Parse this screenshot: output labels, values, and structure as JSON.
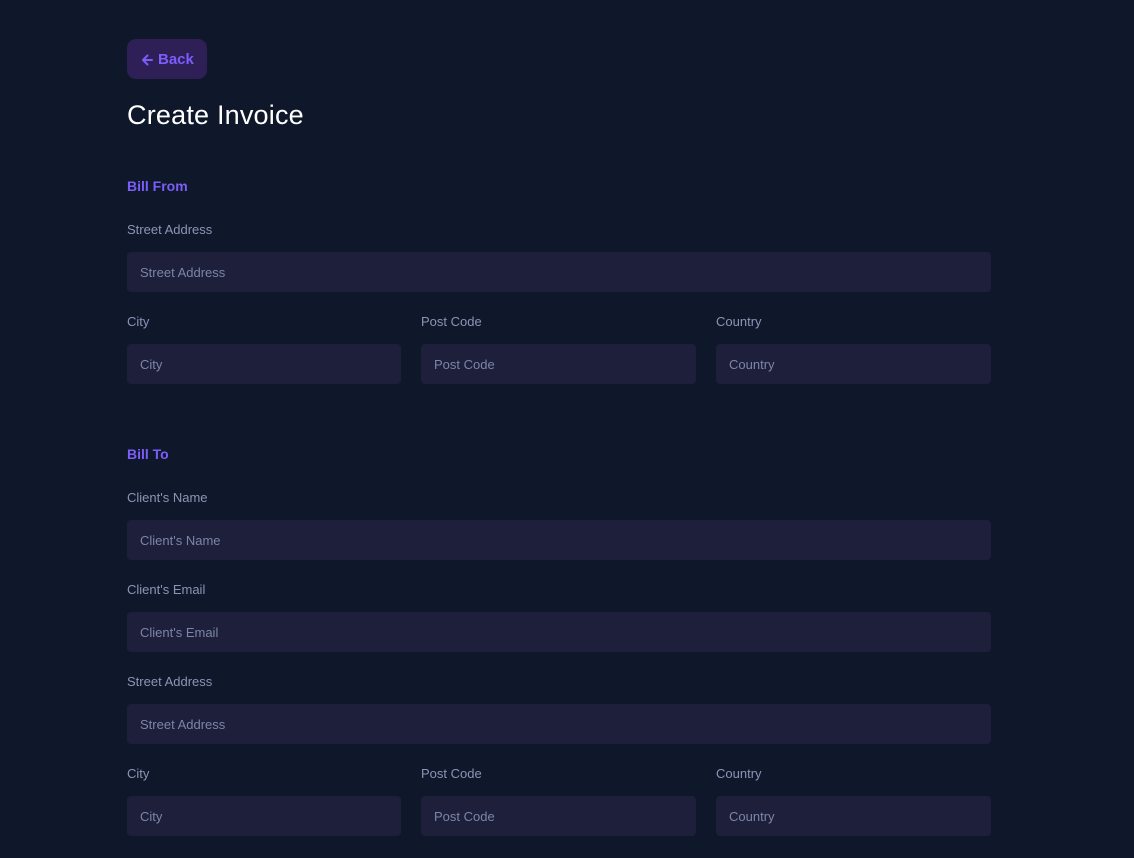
{
  "header": {
    "back_label": "Back",
    "title": "Create Invoice"
  },
  "bill_from": {
    "title": "Bill From",
    "street": {
      "label": "Street Address",
      "placeholder": "Street Address",
      "value": ""
    },
    "city": {
      "label": "City",
      "placeholder": "City",
      "value": ""
    },
    "post_code": {
      "label": "Post Code",
      "placeholder": "Post Code",
      "value": ""
    },
    "country": {
      "label": "Country",
      "placeholder": "Country",
      "value": ""
    }
  },
  "bill_to": {
    "title": "Bill To",
    "client_name": {
      "label": "Client's Name",
      "placeholder": "Client's Name",
      "value": ""
    },
    "client_email": {
      "label": "Client's Email",
      "placeholder": "Client's Email",
      "value": ""
    },
    "street": {
      "label": "Street Address",
      "placeholder": "Street Address",
      "value": ""
    },
    "city": {
      "label": "City",
      "placeholder": "City",
      "value": ""
    },
    "post_code": {
      "label": "Post Code",
      "placeholder": "Post Code",
      "value": ""
    },
    "country": {
      "label": "Country",
      "placeholder": "Country",
      "value": ""
    }
  },
  "colors": {
    "background": "#0f172a",
    "accent": "#7c5dfa",
    "back_button_bg": "#2e1f57",
    "input_bg": "#1e1f3a",
    "label": "#8a95b5"
  },
  "icons": {
    "back": "arrow-left-icon"
  }
}
